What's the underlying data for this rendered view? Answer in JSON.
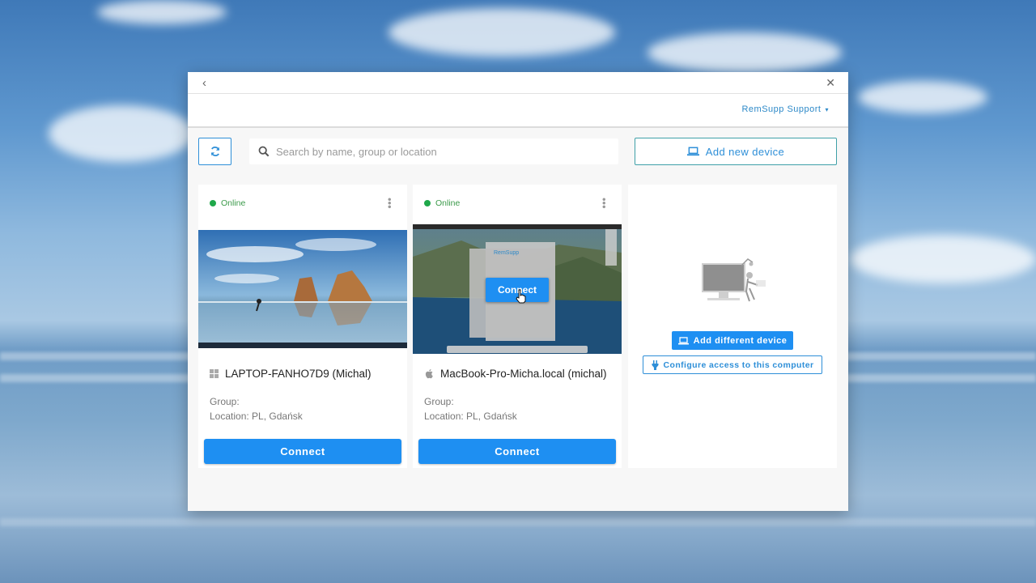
{
  "titlebar": {
    "back_icon": "chevron-left-icon",
    "close_icon": "close-icon"
  },
  "header": {
    "account_label": "RemSupp Support",
    "account_caret": "▾"
  },
  "toolbar": {
    "refresh_icon": "refresh-icon",
    "search": {
      "placeholder": "Search by name, group or location",
      "value": ""
    },
    "add_device_label": "Add new device"
  },
  "devices": [
    {
      "status": "Online",
      "os_icon": "windows-icon",
      "name": "LAPTOP-FANHO7D9 (Michal)",
      "group_label": "Group:",
      "location_label": "Location: PL, Gdańsk",
      "connect_label": "Connect"
    },
    {
      "status": "Online",
      "os_icon": "apple-icon",
      "name": "MacBook-Pro-Micha.local (michal)",
      "group_label": "Group:",
      "location_label": "Location: PL, Gdańsk",
      "connect_label": "Connect",
      "thumb_app_title": "RemSupp",
      "thumb_connect_label": "Connect"
    }
  ],
  "empty_state": {
    "add_different_label": "Add different device",
    "configure_label": "Configure access to this computer"
  },
  "colors": {
    "accent": "#1e8ff2",
    "online": "#1fa84a"
  }
}
